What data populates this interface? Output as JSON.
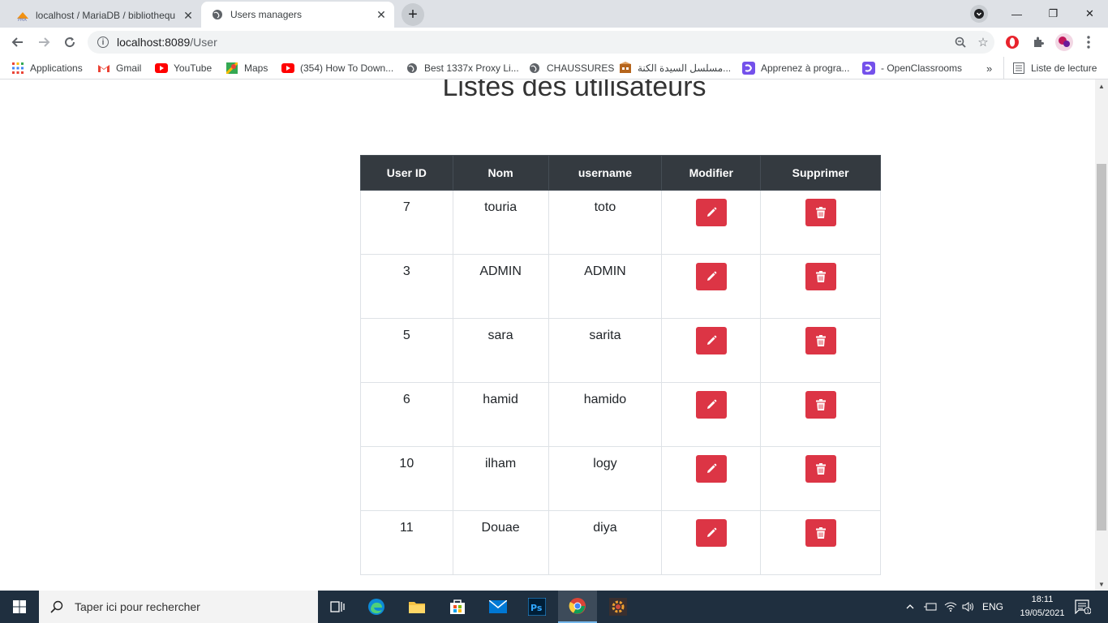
{
  "browser": {
    "tabs": [
      {
        "title": "localhost / MariaDB / bibliothequ"
      },
      {
        "title": "Users managers"
      }
    ],
    "url_host": "localhost:8089",
    "url_path": "/User"
  },
  "bookmarks": [
    {
      "label": "Applications"
    },
    {
      "label": "Gmail"
    },
    {
      "label": "YouTube"
    },
    {
      "label": "Maps"
    },
    {
      "label": "(354) How To Down..."
    },
    {
      "label": "Best 1337x Proxy Li..."
    },
    {
      "label": "CHAUSSURES"
    },
    {
      "label": "مسلسل السيدة الكنة..."
    },
    {
      "label": "Apprenez à progra..."
    },
    {
      "label": "- OpenClassrooms"
    }
  ],
  "reading_list": "Liste de lecture",
  "page": {
    "title": "Listes des utilisateurs",
    "table": {
      "headers": [
        "User ID",
        "Nom",
        "username",
        "Modifier",
        "Supprimer"
      ],
      "rows": [
        {
          "id": "7",
          "nom": "touria",
          "username": "toto"
        },
        {
          "id": "3",
          "nom": "ADMIN",
          "username": "ADMIN"
        },
        {
          "id": "5",
          "nom": "sara",
          "username": "sarita"
        },
        {
          "id": "6",
          "nom": "hamid",
          "username": "hamido"
        },
        {
          "id": "10",
          "nom": "ilham",
          "username": "logy"
        },
        {
          "id": "11",
          "nom": "Douae",
          "username": "diya"
        }
      ]
    }
  },
  "taskbar": {
    "search_placeholder": "Taper ici pour rechercher",
    "language": "ENG",
    "time": "18:11",
    "date": "19/05/2021",
    "notification_count": "1"
  },
  "colors": {
    "danger": "#dc3545",
    "table_header": "#343a40"
  }
}
